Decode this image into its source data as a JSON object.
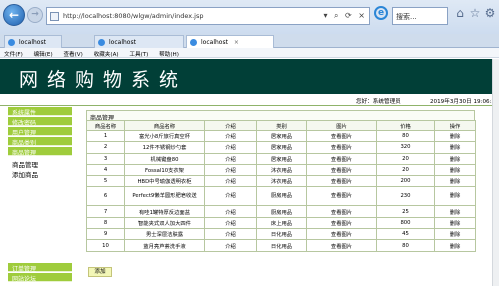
{
  "browser": {
    "url": "http://localhost:8080/wlgw/admin/index.jsp",
    "search_placeholder": "搜索...",
    "address_icons": [
      "▾",
      "⌕",
      "⟳",
      "×"
    ],
    "tabs": [
      {
        "label": "localhost",
        "active": false
      },
      {
        "label": "localhost",
        "active": false
      },
      {
        "label": "localhost",
        "active": true
      }
    ],
    "menu": [
      "文件(F)",
      "编辑(E)",
      "查看(V)",
      "收藏夹(A)",
      "工具(T)",
      "帮助(H)"
    ]
  },
  "app": {
    "title": "网络购物系统",
    "welcome": "您好：系统管理员",
    "datetime": "2019年3月30日  19:06:21",
    "banner_color": "#013f37",
    "accent_color": "#9fcc3c"
  },
  "sidebar": {
    "items_top": [
      "系统属性",
      "修改密码",
      "用户管理",
      "商品类别",
      "商品管理"
    ],
    "subitems": [
      "商品管理",
      "添加商品"
    ],
    "items_bottom": [
      "订单管理",
      "网站论坛"
    ]
  },
  "main": {
    "section_title": "商品管理",
    "columns": [
      "商品名称",
      "商品名称",
      "介绍",
      "类别",
      "图片",
      "价格",
      "操作"
    ],
    "rows": [
      [
        "1",
        "富光小8斤旅行真空杯",
        "介绍",
        "居家用品",
        "查看图片",
        "80",
        "删除"
      ],
      [
        "2",
        "12件不锈钢炒勺套",
        "介绍",
        "居家用品",
        "查看图片",
        "320",
        "删除"
      ],
      [
        "3",
        "机械键盘80",
        "介绍",
        "居家用品",
        "查看图片",
        "20",
        "删除"
      ],
      [
        "4",
        "Fossal10支衣架",
        "介绍",
        "沐衣用品",
        "查看图片",
        "20",
        "删除"
      ],
      [
        "5",
        "HBD中号瑜伽透明衣柜",
        "介绍",
        "沐衣用品",
        "查看图片",
        "200",
        "删除"
      ],
      [
        "6",
        "Perfect9懒羊圆形肥皂收送",
        "介绍",
        "厨房用品",
        "查看图片",
        "230",
        "删除"
      ],
      [
        "7",
        "有哇1罐特厚反边面盆",
        "介绍",
        "厨房用品",
        "查看图片",
        "25",
        "删除"
      ],
      [
        "8",
        "智能夹式双人加大四件",
        "介绍",
        "床上用品",
        "查看图片",
        "800",
        "删除"
      ],
      [
        "9",
        "男士深层洁肤露",
        "介绍",
        "日化用品",
        "查看图片",
        "45",
        "删除"
      ],
      [
        "10",
        "蓝月亮芦荟洗手液",
        "介绍",
        "日化用品",
        "查看图片",
        "80",
        "删除"
      ]
    ],
    "add_label": "添加"
  }
}
